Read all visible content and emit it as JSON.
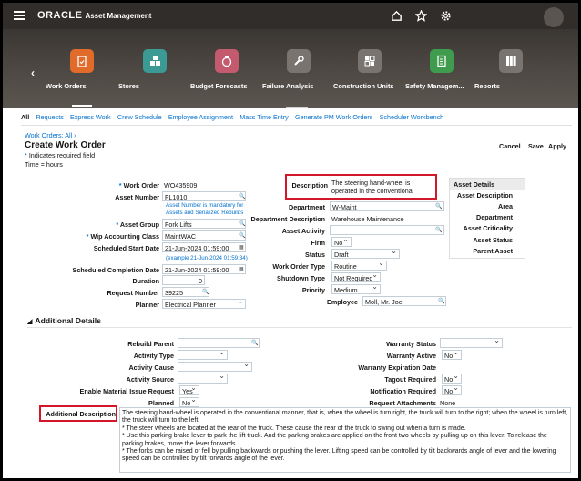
{
  "header": {
    "brand": "ORACLE",
    "app": "Asset Management"
  },
  "springboard": {
    "tiles": [
      {
        "label": "Work Orders",
        "color": "#e06b2a",
        "icon": "clipboard-icon"
      },
      {
        "label": "Stores",
        "color": "#3b9b94",
        "icon": "stack-icon"
      },
      {
        "label": "Budget Forecasts",
        "color": "#c45a6e",
        "icon": "money-bag-icon"
      },
      {
        "label": "Failure Analysis",
        "color": "#7a7470",
        "icon": "wrench-icon"
      },
      {
        "label": "Construction Units",
        "color": "#7a7470",
        "icon": "puzzle-icon"
      },
      {
        "label": "Safety Managem...",
        "color": "#3f9b4e",
        "icon": "notebook-icon"
      },
      {
        "label": "Reports",
        "color": "#7a7470",
        "icon": "binders-icon"
      }
    ]
  },
  "subtabs": [
    "All",
    "Requests",
    "Express Work",
    "Crew Schedule",
    "Employee Assignment",
    "Mass Time Entry",
    "Generate PM Work Orders",
    "Scheduler Workbench"
  ],
  "breadcrumb": "Work Orders: All",
  "page_title": "Create Work Order",
  "required_note": "Indicates required field",
  "time_note": "Time = hours",
  "actions": {
    "cancel": "Cancel",
    "save": "Save",
    "apply": "Apply"
  },
  "form_left": {
    "work_order": {
      "label": "Work Order",
      "value": "WO435909"
    },
    "asset_number": {
      "label": "Asset Number",
      "value": "FL1010",
      "note_line1": "Asset Number is mandatory for",
      "note_line2": "Assets and Serialized Rebuilds"
    },
    "asset_group": {
      "label": "Asset Group",
      "value": "Fork Lifts"
    },
    "wip_class": {
      "label": "Wip Accounting Class",
      "value": "MaintWAC"
    },
    "sched_start": {
      "label": "Scheduled Start Date",
      "value": "21-Jun-2024 01:59:00",
      "example": "(example 21-Jun-2024 01:59:34)"
    },
    "sched_completion": {
      "label": "Scheduled Completion Date",
      "value": "21-Jun-2024 01:59:00"
    },
    "duration": {
      "label": "Duration",
      "value": "0"
    },
    "request_number": {
      "label": "Request Number",
      "value": "39225"
    },
    "planner": {
      "label": "Planner",
      "value": "Electrical Planner"
    }
  },
  "form_mid": {
    "description": {
      "label": "Description",
      "value_line1": "The steering hand-wheel is",
      "value_line2": "operated in the conventional"
    },
    "department": {
      "label": "Department",
      "value": "W-Maint"
    },
    "department_description": {
      "label": "Department Description",
      "value": "Warehouse Maintenance"
    },
    "asset_activity": {
      "label": "Asset Activity",
      "value": ""
    },
    "firm": {
      "label": "Firm",
      "value": "No"
    },
    "status": {
      "label": "Status",
      "value": "Draft"
    },
    "work_order_type": {
      "label": "Work Order Type",
      "value": "Routine"
    },
    "shutdown_type": {
      "label": "Shutdown Type",
      "value": "Not Required"
    },
    "priority": {
      "label": "Priority",
      "value": "Medium"
    },
    "employee": {
      "label": "Employee",
      "value": "Moll, Mr. Joe"
    }
  },
  "asset_details": {
    "title": "Asset Details",
    "fields": [
      "Asset Description",
      "Area",
      "Department",
      "Asset Criticality",
      "Asset Status",
      "Parent Asset"
    ]
  },
  "additional": {
    "title": "Additional Details",
    "left": [
      {
        "label": "Rebuild Parent",
        "value": ""
      },
      {
        "label": "Activity Type",
        "value": ""
      },
      {
        "label": "Activity Cause",
        "value": ""
      },
      {
        "label": "Activity Source",
        "value": ""
      },
      {
        "label": "Enable Material Issue Request",
        "value": "Yes"
      },
      {
        "label": "Planned",
        "value": "No"
      }
    ],
    "right": [
      {
        "label": "Warranty Status",
        "value": ""
      },
      {
        "label": "Warranty Active",
        "value": "No"
      },
      {
        "label": "Warranty Expiration Date",
        "value": ""
      },
      {
        "label": "Tagout Required",
        "value": "No"
      },
      {
        "label": "Notification Required",
        "value": "No"
      },
      {
        "label": "Request Attachments",
        "value": "None"
      }
    ],
    "long_label": "Additional Description",
    "long_text": [
      "The steering hand-wheel is operated in the conventional manner, that is, when the wheel is turn right, the truck will turn to the right; when the wheel is turn left, the truck will turn to the left.",
      "* The steer wheels are located at the rear of the truck. These cause the rear of the truck to swing out when a turn is made.",
      "* Use this parking brake lever to park the lift truck. And the parking brakes are applied on the front two wheels by pulling up on this lever. To release the parking brakes, move the lever forwards.",
      "* The forks can be raised or fell by pulling backwards or pushing the lever. Lifting speed can be controlled by tilt backwards angle of lever and the lowering speed can be controlled by tilt forwards angle of the lever."
    ]
  },
  "colors": {
    "highlight": "#d5152a",
    "link": "#0572ce",
    "header": "#312d2a"
  }
}
